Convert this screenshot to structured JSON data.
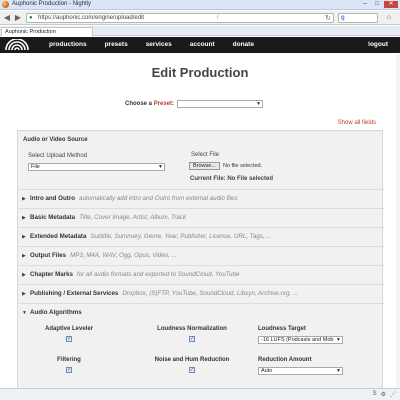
{
  "browser": {
    "window_title": "Auphonic Production - Nightly",
    "url": "https://auphonic.com/engine/upload/edit",
    "url_marker": "/",
    "tab_title": "Auphonic Production",
    "controls": {
      "minimize": "–",
      "maximize": "□",
      "close": "✕"
    },
    "nav": {
      "back": "◀",
      "forward": "▶",
      "reload": "↻",
      "home": "⌂"
    },
    "search_engine_glyph": "g"
  },
  "site": {
    "nav_items": [
      "productions",
      "presets",
      "services",
      "account",
      "donate"
    ],
    "logout": "logout"
  },
  "page": {
    "title": "Edit Production",
    "preset_label_prefix": "Choose a ",
    "preset_label_accent": "Preset",
    "preset_label_suffix": ":",
    "preset_value": "",
    "show_all_fields": "Show all fields"
  },
  "source": {
    "title": "Audio or Video Source",
    "upload_method_label": "Select Upload Method",
    "upload_method_value": "File",
    "select_file_label": "Select File",
    "browse_button": "Browse...",
    "no_file": "No file selected.",
    "current_file": "Current File: No File selected"
  },
  "sections": [
    {
      "name": "Intro and Outro",
      "desc": "automatically add intro and Outro from external audio files",
      "expanded": false
    },
    {
      "name": "Basic Metadata",
      "desc": "Title, Cover Image, Artist, Album, Track",
      "expanded": false
    },
    {
      "name": "Extended Metadata",
      "desc": "Subtitle, Summary, Genre, Year, Publisher, License, URL, Tags, ...",
      "expanded": false
    },
    {
      "name": "Output Files",
      "desc": "MP3, M4A, WAV, Ogg, Opus, Video, ...",
      "expanded": false
    },
    {
      "name": "Chapter Marks",
      "desc": "for all audio formats and exported to SoundCloud, YouTube",
      "expanded": false
    },
    {
      "name": "Publishing / External Services",
      "desc": "Dropbox, (S)FTP, YouTube, SoundCloud, Libsyn, Archive.org, ...",
      "expanded": false
    },
    {
      "name": "Audio Algorithms",
      "desc": "",
      "expanded": true
    }
  ],
  "algorithms": {
    "adaptive_leveler": "Adaptive Leveler",
    "loudness_normalization": "Loudness Normalization",
    "loudness_target": "Loudness Target",
    "loudness_target_value": "-16 LUFS (Podcasts and Mob",
    "filtering": "Filtering",
    "noise_hum_reduction": "Noise and Hum Reduction",
    "reduction_amount": "Reduction Amount",
    "reduction_amount_value": "Auto",
    "checkmark": "✓"
  },
  "colors": {
    "site_nav": "#1a1a1a",
    "accent_red": "#c0392b",
    "panel_bg": "#f1f1f1"
  }
}
